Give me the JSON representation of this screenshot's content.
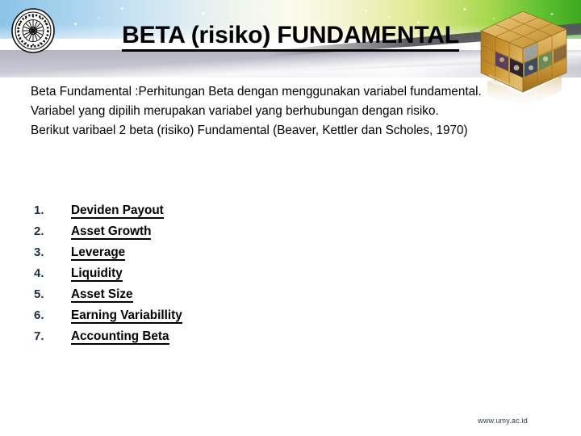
{
  "slide": {
    "title": "BETA (risiko) FUNDAMENTAL",
    "logo_name": "umy-university-seal-logo",
    "cube_name": "golden-photo-cube-graphic",
    "footer_url": "www.umy.ac.id",
    "colors": {
      "title_text": "#000000",
      "body_text": "#000000",
      "list_number": "#1b3047",
      "footer_text": "#1e3a48",
      "band_left": "#8cc3e8",
      "band_right": "#3ea81f",
      "cube_gold": "#c8932f"
    }
  },
  "body": {
    "paragraphs": [
      "Beta Fundamental :Perhitungan Beta dengan menggunakan variabel fundamental.",
      "Variabel yang dipilih merupakan variabel yang berhubungan dengan risiko.",
      "Berikut varibael 2 beta (risiko) Fundamental (Beaver, Kettler dan Scholes, 1970)"
    ]
  },
  "list": {
    "items": [
      {
        "number": "1.",
        "label": "Deviden Payout"
      },
      {
        "number": "2.",
        "label": "Asset Growth"
      },
      {
        "number": "3.",
        "label": "Leverage"
      },
      {
        "number": "4.",
        "label": "Liquidity"
      },
      {
        "number": "5.",
        "label": "Asset Size"
      },
      {
        "number": "6.",
        "label": "Earning Variabillity"
      },
      {
        "number": "7.",
        "label": "Accounting Beta"
      }
    ]
  }
}
